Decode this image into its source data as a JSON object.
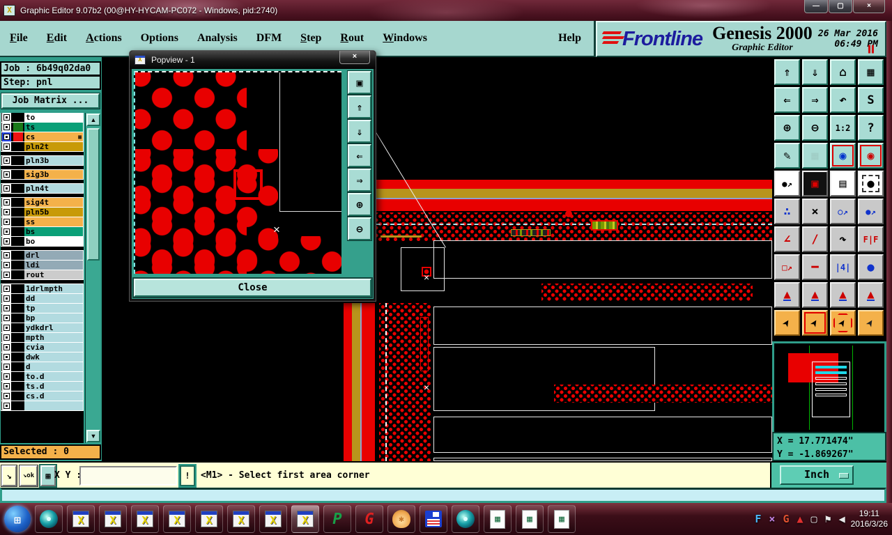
{
  "window": {
    "title": "Graphic Editor 9.07b2 (00@HY-HYCAM-PC072 - Windows, pid:2740)"
  },
  "icons": {
    "app": "X",
    "minimize": "—",
    "maximize": "▢",
    "close": "×",
    "dialog_close": "×",
    "scroll_up": "▲",
    "scroll_down": "▼",
    "pause": "▌▌",
    "snap": "↘",
    "snap_ok": "↘ok",
    "grid": "▦",
    "start": "⊞"
  },
  "menubar": {
    "items": [
      {
        "label": "File",
        "u": 1,
        "name": "menu-file"
      },
      {
        "label": "Edit",
        "u": 1,
        "name": "menu-edit"
      },
      {
        "label": "Actions",
        "u": 1,
        "name": "menu-actions"
      },
      {
        "label": "Options",
        "name": "menu-options"
      },
      {
        "label": "Analysis",
        "name": "menu-analysis"
      },
      {
        "label": "DFM",
        "name": "menu-dfm"
      },
      {
        "label": "Step",
        "u": 1,
        "name": "menu-step"
      },
      {
        "label": "Rout",
        "u": 1,
        "name": "menu-rout"
      },
      {
        "label": "Windows",
        "u": 1,
        "name": "menu-windows"
      }
    ],
    "help_label": "Help"
  },
  "brand": {
    "logo": "Frontline",
    "product": "Genesis 2000",
    "subtitle": "Graphic Editor",
    "date": "26 Mar 2016",
    "time": "06:49 PM"
  },
  "sidebar": {
    "job_label": "Job :",
    "job_value": "6b49q02da0",
    "step_label": "Step:",
    "step_value": "pnl",
    "job_matrix_label": "Job Matrix ...",
    "selected_label": "Selected : 0",
    "layers": [
      {
        "name": "to",
        "chip": "#ffffff",
        "swatch": "#000000"
      },
      {
        "name": "ts",
        "chip": "#0aa078",
        "swatch": "#1a7a1a"
      },
      {
        "name": "cs",
        "chip": "#f4b14a",
        "swatch": "#ee1111",
        "cls": "active",
        "extra": "▦"
      },
      {
        "name": "pln2t",
        "chip": "#c89a08",
        "swatch": "#000000"
      },
      {
        "name": "pln3b",
        "chip": "#b2dbe0",
        "swatch": "#000000",
        "cls": "gap"
      },
      {
        "name": "sig3b",
        "chip": "#f4b14a",
        "swatch": "#000000",
        "cls": "gap"
      },
      {
        "name": "pln4t",
        "chip": "#b2dbe0",
        "swatch": "#000000",
        "cls": "gap"
      },
      {
        "name": "sig4t",
        "chip": "#f4b14a",
        "swatch": "#000000",
        "cls": "gap"
      },
      {
        "name": "pln5b",
        "chip": "#c89a08",
        "swatch": "#000000"
      },
      {
        "name": "ss",
        "chip": "#f4b14a",
        "swatch": "#000000"
      },
      {
        "name": "bs",
        "chip": "#0aa078",
        "swatch": "#000000"
      },
      {
        "name": "bo",
        "chip": "#ffffff",
        "swatch": "#000000"
      },
      {
        "name": "drl",
        "chip": "#93aab6",
        "swatch": "#000000",
        "cls": "gap"
      },
      {
        "name": "ldi",
        "chip": "#93aab6",
        "swatch": "#000000"
      },
      {
        "name": "rout",
        "chip": "#cccccc",
        "swatch": "#000000"
      },
      {
        "name": "1drlmpth",
        "chip": "#b2dbe0",
        "swatch": "#000000",
        "cls": "gap"
      },
      {
        "name": "dd",
        "chip": "#b2dbe0",
        "swatch": "#000000"
      },
      {
        "name": "tp",
        "chip": "#b2dbe0",
        "swatch": "#000000"
      },
      {
        "name": "bp",
        "chip": "#b2dbe0",
        "swatch": "#000000"
      },
      {
        "name": "ydkdrl",
        "chip": "#b2dbe0",
        "swatch": "#000000"
      },
      {
        "name": "mpth",
        "chip": "#b2dbe0",
        "swatch": "#000000"
      },
      {
        "name": "cvia",
        "chip": "#b2dbe0",
        "swatch": "#000000"
      },
      {
        "name": "dwk",
        "chip": "#b2dbe0",
        "swatch": "#000000"
      },
      {
        "name": "d",
        "chip": "#b2dbe0",
        "swatch": "#000000"
      },
      {
        "name": "to.d",
        "chip": "#b2dbe0",
        "swatch": "#000000"
      },
      {
        "name": "ts.d",
        "chip": "#b2dbe0",
        "swatch": "#000000"
      },
      {
        "name": "cs.d",
        "chip": "#b2dbe0",
        "swatch": "#000000"
      },
      {
        "name": "",
        "chip": "#b2dbe0",
        "swatch": "#000000"
      }
    ]
  },
  "popview": {
    "title": "Popview - 1",
    "close_label": "Close",
    "side_buttons": [
      {
        "name": "popview-window-button",
        "g": "▣"
      },
      {
        "name": "popview-pan-up-button",
        "g": "⇑"
      },
      {
        "name": "popview-pan-down-button",
        "g": "⇓"
      },
      {
        "name": "popview-pan-left-button",
        "g": "⇐"
      },
      {
        "name": "popview-pan-right-button",
        "g": "⇒"
      },
      {
        "name": "popview-zoom-fit-button",
        "g": "⊕"
      },
      {
        "name": "popview-zoom-center-button",
        "g": "⊖"
      }
    ]
  },
  "toolbar": {
    "buttons": [
      {
        "name": "view-up-button",
        "g": "⇑",
        "cls": "t"
      },
      {
        "name": "view-down-button",
        "g": "⇓",
        "cls": "t"
      },
      {
        "name": "home-view-button",
        "g": "⌂",
        "cls": "t"
      },
      {
        "name": "xy-window-button",
        "g": "▦",
        "cls": "t"
      },
      {
        "name": "view-left-button",
        "g": "⇐",
        "cls": "t"
      },
      {
        "name": "view-right-button",
        "g": "⇒",
        "cls": "t"
      },
      {
        "name": "previous-view-button",
        "g": "↶",
        "cls": "t"
      },
      {
        "name": "profile-view-button",
        "g": "S",
        "cls": "t"
      },
      {
        "name": "zoom-in-button",
        "g": "⊕",
        "cls": "t"
      },
      {
        "name": "zoom-out-button",
        "g": "⊖",
        "cls": "t"
      },
      {
        "name": "zoom-ratio-button",
        "g": "1:2",
        "cls": "t sm"
      },
      {
        "name": "help-button",
        "g": "?",
        "cls": "t"
      },
      {
        "name": "setup-tools-button",
        "g": "✎",
        "cls": "t"
      },
      {
        "name": "grid-button",
        "g": "▦",
        "cls": "t faint"
      },
      {
        "name": "color-priority-button",
        "g": "◉",
        "fg": "#0033cc",
        "cls": "t redframe"
      },
      {
        "name": "display-colors-button",
        "g": "◉",
        "fg": "#cc0000",
        "cls": "t redframe"
      },
      {
        "name": "symbol-button",
        "g": "●↗",
        "cls": "w sm"
      },
      {
        "name": "active-layer-button",
        "g": "▣",
        "fg": "#dd0000",
        "cls": "w dark"
      },
      {
        "name": "measure-button",
        "g": "▤",
        "cls": "w"
      },
      {
        "name": "pad-button",
        "g": "●",
        "cls": "w dashbox"
      },
      {
        "name": "chain-select-button",
        "g": "∴",
        "fg": "#1133cc",
        "cls": "g"
      },
      {
        "name": "delete-button",
        "g": "×",
        "cls": "g"
      },
      {
        "name": "copy-to-layer-button",
        "g": "○↗",
        "fg": "#1133cc",
        "cls": "g sm"
      },
      {
        "name": "move-to-layer-button",
        "g": "●↗",
        "fg": "#1133cc",
        "cls": "g sm"
      },
      {
        "name": "angle-button",
        "g": "∠",
        "fg": "#cc0000",
        "cls": "g"
      },
      {
        "name": "slope-button",
        "g": "/",
        "fg": "#cc0000",
        "cls": "g"
      },
      {
        "name": "rotate-button",
        "g": "↷",
        "cls": "g"
      },
      {
        "name": "mirror-button",
        "g": "F|F",
        "fg": "#cc0000",
        "cls": "g sm"
      },
      {
        "name": "resize-button",
        "g": "□↗",
        "fg": "#cc0000",
        "cls": "g sm"
      },
      {
        "name": "break-button",
        "g": "━",
        "fg": "#cc0000",
        "cls": "g"
      },
      {
        "name": "dimension-button",
        "g": "|4|",
        "fg": "#1133cc",
        "cls": "g sm"
      },
      {
        "name": "surface-button",
        "g": "●",
        "fg": "#1133cc",
        "cls": "g"
      },
      {
        "name": "select-mode-1-button",
        "g": "▲",
        "fg": "#cc0000",
        "cls": "g tri"
      },
      {
        "name": "select-mode-2-button",
        "g": "▲",
        "fg": "#cc0000",
        "cls": "g tri"
      },
      {
        "name": "select-mode-3-button",
        "g": "▲",
        "fg": "#cc0000",
        "cls": "g tri"
      },
      {
        "name": "select-mode-4-button",
        "g": "▲",
        "fg": "#cc0000",
        "cls": "g tri"
      },
      {
        "name": "select-pointer-button",
        "g": "➤",
        "cls": "o cur"
      },
      {
        "name": "select-frame-button",
        "g": "➤",
        "cls": "o cur redframe"
      },
      {
        "name": "select-polygon-button",
        "g": "➤",
        "cls": "o cur octframe"
      },
      {
        "name": "select-net-button",
        "g": "➤",
        "fg": "#222",
        "cls": "o cur"
      }
    ]
  },
  "minimap": {
    "x_coord": "X = 17.771474\"",
    "y_coord": "Y = -1.869267\""
  },
  "statusbar": {
    "xy_label": "X Y :",
    "input_value": "",
    "bang_label": "!",
    "message": "<M1> - Select first area corner",
    "unit": "Inch"
  },
  "taskbar": {
    "items": [
      {
        "name": "start-button",
        "cls": "start",
        "g": "⊞"
      },
      {
        "name": "media-player-button",
        "cls": "disc"
      },
      {
        "name": "genesis-window-1-button",
        "cls": "xwin",
        "g": "X"
      },
      {
        "name": "genesis-window-2-button",
        "cls": "xwin",
        "g": "X"
      },
      {
        "name": "genesis-window-3-button",
        "cls": "xwin",
        "g": "X"
      },
      {
        "name": "genesis-window-4-button",
        "cls": "xwin",
        "g": "X"
      },
      {
        "name": "genesis-window-5-button",
        "cls": "xwin",
        "g": "X"
      },
      {
        "name": "genesis-window-6-button",
        "cls": "xwin",
        "g": "X"
      },
      {
        "name": "genesis-window-7-button",
        "cls": "xwin",
        "g": "X"
      },
      {
        "name": "genesis-window-8-button",
        "cls": "xwin lit",
        "g": "X"
      },
      {
        "name": "p-app-button",
        "cls": "papp",
        "g": "P"
      },
      {
        "name": "g-app-button",
        "cls": "gapp",
        "g": "G"
      },
      {
        "name": "shell-app-button",
        "cls": "shell",
        "g": "✱"
      },
      {
        "name": "save-tool-button",
        "cls": "floppy"
      },
      {
        "name": "media-player-2-button",
        "cls": "disc"
      },
      {
        "name": "excel-doc-1-button",
        "cls": "excel",
        "g": "▦"
      },
      {
        "name": "excel-doc-2-button",
        "cls": "excel",
        "g": "▦"
      },
      {
        "name": "excel-doc-3-button",
        "cls": "excel",
        "g": "▦"
      }
    ],
    "tray": [
      {
        "name": "flash-tray-icon",
        "g": "F",
        "fg": "#4ab8f8"
      },
      {
        "name": "x-tray-icon",
        "g": "×",
        "fg": "#c080e0"
      },
      {
        "name": "mail-tray-icon",
        "g": "G",
        "fg": "#e05030"
      },
      {
        "name": "chart-tray-icon",
        "g": "▲",
        "fg": "#e03030"
      },
      {
        "name": "network-tray-icon",
        "g": "▢",
        "fg": "#e8e8e8"
      },
      {
        "name": "flag-tray-icon",
        "g": "⚑",
        "fg": "#e8e8e8"
      },
      {
        "name": "volume-tray-icon",
        "g": "◀",
        "fg": "#e8e8e8"
      }
    ],
    "time": "19:11",
    "date": "2016/3/26"
  }
}
